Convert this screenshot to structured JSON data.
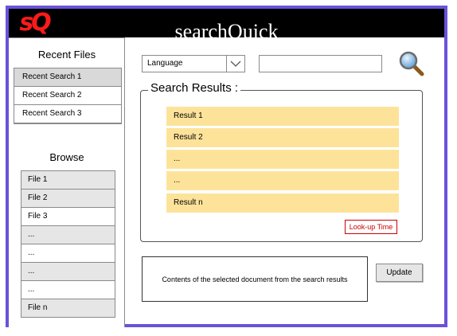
{
  "app": {
    "logo_text": "sQ",
    "title": "searchQuick"
  },
  "sidebar": {
    "recent_title": "Recent Files",
    "recent_items": [
      "Recent Search 1",
      "Recent Search 2",
      "Recent Search 3"
    ],
    "browse_title": "Browse",
    "browse_items": [
      "File 1",
      "File 2",
      "File 3",
      "...",
      "...",
      "...",
      "...",
      "File n"
    ]
  },
  "search": {
    "language_selected": "Language",
    "query_value": "",
    "results_legend": "Search Results :",
    "results": [
      "Result 1",
      "Result 2",
      "...",
      "...",
      "Result n"
    ],
    "lookup_label": "Look-up Time"
  },
  "document": {
    "preview_text": "Contents of the selected document from the search results",
    "update_label": "Update"
  },
  "colors": {
    "accent_border": "#6a52d8",
    "result_fill": "#fde39a",
    "lookup_red": "#cc0000",
    "logo_red": "#ff1a1a"
  }
}
